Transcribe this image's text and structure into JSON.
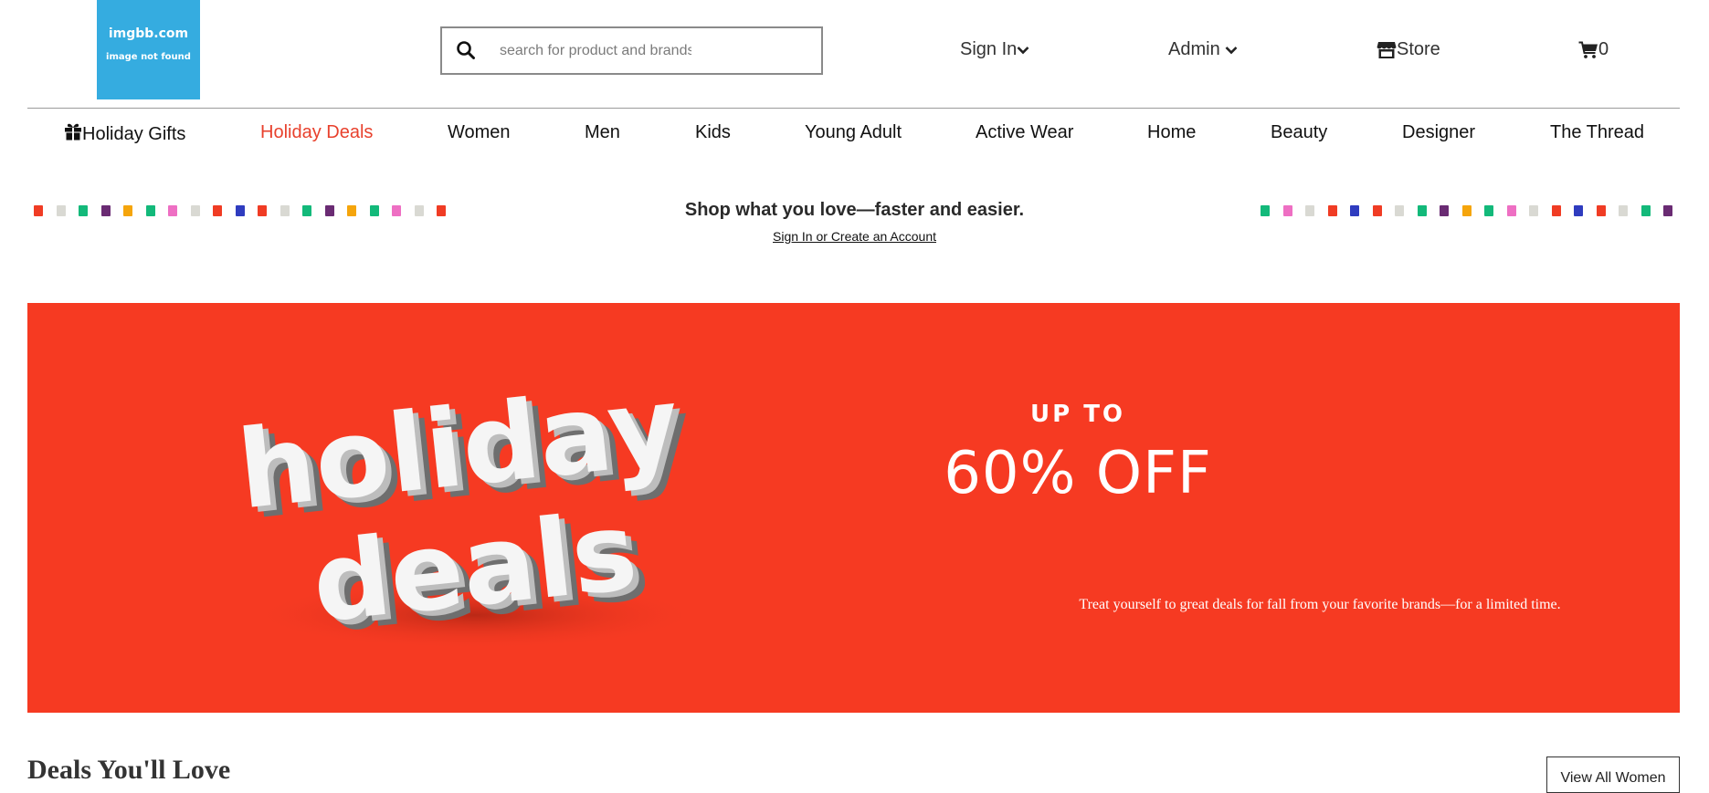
{
  "logo": {
    "line1": "imgbb.com",
    "line2": "image not found"
  },
  "search": {
    "placeholder": "search for product and brands",
    "value": ""
  },
  "header_nav": {
    "sign_in": "Sign In",
    "admin": "Admin",
    "store": "Store",
    "cart_count": "0"
  },
  "categories": [
    "Holiday Gifts",
    "Holiday Deals",
    "Women",
    "Men",
    "Kids",
    "Young Adult",
    "Active Wear",
    "Home",
    "Beauty",
    "Designer",
    "The Thread"
  ],
  "active_category": "Holiday Deals",
  "signin_banner": {
    "message": "Shop what you love—faster and easier.",
    "link": "Sign In or Create an Account"
  },
  "hero": {
    "word1": "holiday",
    "word2": "deals",
    "up_to": "UP TO",
    "discount": "60% OFF",
    "subtext": "Treat yourself to great deals for fall from your favorite brands—for a limited time."
  },
  "section": {
    "title": "Deals You'll Love",
    "button": "View All Women"
  },
  "colors": {
    "accent_red": "#f63a22",
    "active_nav": "#e8412d",
    "logo_blue": "#35ace0",
    "dot_palette": [
      "#f03c24",
      "#d9d9d3",
      "#13b97a",
      "#6a2b73",
      "#f5a50c",
      "#ee6fc3",
      "#2f3cbf"
    ]
  }
}
